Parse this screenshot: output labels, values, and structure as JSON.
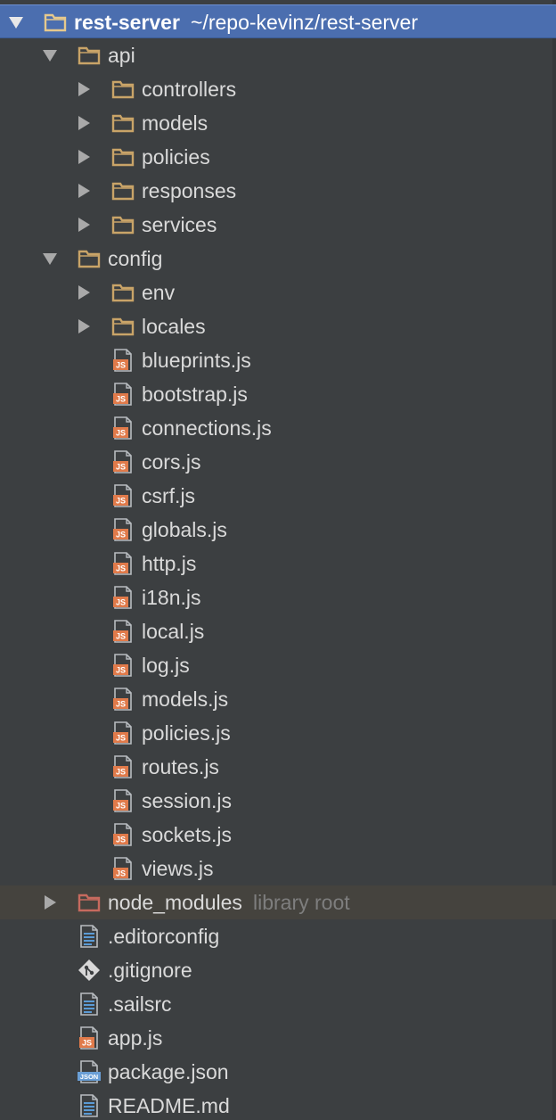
{
  "project": {
    "name": "rest-server",
    "path": "~/repo-kevinz/rest-server"
  },
  "colors": {
    "selection": "#4b6eaf",
    "folder": "#c9a468",
    "excluded_folder": "#c76a5e",
    "js_badge": "#e07a4a",
    "json_badge": "#6a9fd6",
    "text": "#dadada",
    "dim_text": "#7e7e7e"
  },
  "tree": [
    {
      "label": "rest-server",
      "suffix": "~/repo-kevinz/rest-server",
      "type": "folder",
      "expanded": true,
      "selected": true
    },
    {
      "label": "api",
      "type": "folder",
      "expanded": true
    },
    {
      "label": "controllers",
      "type": "folder",
      "expanded": false
    },
    {
      "label": "models",
      "type": "folder",
      "expanded": false
    },
    {
      "label": "policies",
      "type": "folder",
      "expanded": false
    },
    {
      "label": "responses",
      "type": "folder",
      "expanded": false
    },
    {
      "label": "services",
      "type": "folder",
      "expanded": false
    },
    {
      "label": "config",
      "type": "folder",
      "expanded": true
    },
    {
      "label": "env",
      "type": "folder",
      "expanded": false
    },
    {
      "label": "locales",
      "type": "folder",
      "expanded": false
    },
    {
      "label": "blueprints.js",
      "type": "js"
    },
    {
      "label": "bootstrap.js",
      "type": "js"
    },
    {
      "label": "connections.js",
      "type": "js"
    },
    {
      "label": "cors.js",
      "type": "js"
    },
    {
      "label": "csrf.js",
      "type": "js"
    },
    {
      "label": "globals.js",
      "type": "js"
    },
    {
      "label": "http.js",
      "type": "js"
    },
    {
      "label": "i18n.js",
      "type": "js"
    },
    {
      "label": "local.js",
      "type": "js"
    },
    {
      "label": "log.js",
      "type": "js"
    },
    {
      "label": "models.js",
      "type": "js"
    },
    {
      "label": "policies.js",
      "type": "js"
    },
    {
      "label": "routes.js",
      "type": "js"
    },
    {
      "label": "session.js",
      "type": "js"
    },
    {
      "label": "sockets.js",
      "type": "js"
    },
    {
      "label": "views.js",
      "type": "js"
    },
    {
      "label": "node_modules",
      "suffix": "library root",
      "type": "excluded-folder",
      "expanded": false
    },
    {
      "label": ".editorconfig",
      "type": "text"
    },
    {
      "label": ".gitignore",
      "type": "git"
    },
    {
      "label": ".sailsrc",
      "type": "text"
    },
    {
      "label": "app.js",
      "type": "js"
    },
    {
      "label": "package.json",
      "type": "json"
    },
    {
      "label": "README.md",
      "type": "text"
    }
  ],
  "icon_names": {
    "folder": "folder-icon",
    "excluded-folder": "excluded-folder-icon",
    "js": "javascript-file-icon",
    "json": "json-file-icon",
    "text": "text-file-icon",
    "git": "git-file-icon"
  },
  "badges": {
    "js": "JS",
    "json": "JSON"
  }
}
